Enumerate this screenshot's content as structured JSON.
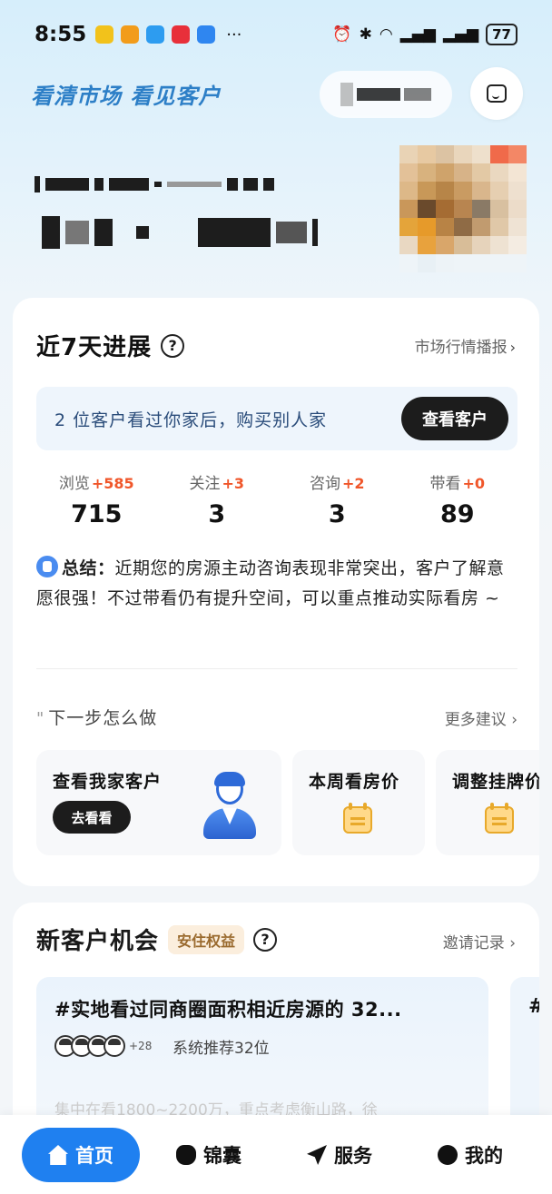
{
  "status_bar": {
    "time": "8:55",
    "battery": "77",
    "more": "···",
    "app_icon_colors": [
      "#f2c21b",
      "#f29c1b",
      "#2d9cf0",
      "#e8303a",
      "#2f86f0"
    ]
  },
  "header": {
    "slogan": "看清市场 看见客户",
    "message_icon": "message-square-icon"
  },
  "progress_card": {
    "title": "近7天进展",
    "market_link": "市场行情播报",
    "alert": {
      "text": "2 位客户看过你家后，购买别人家",
      "button": "查看客户"
    },
    "stats": [
      {
        "label": "浏览",
        "delta": "+585",
        "value": "715"
      },
      {
        "label": "关注",
        "delta": "+3",
        "value": "3"
      },
      {
        "label": "咨询",
        "delta": "+2",
        "value": "3"
      },
      {
        "label": "带看",
        "delta": "+0",
        "value": "89"
      }
    ],
    "summary_label": "总结：",
    "summary_text": "近期您的房源主动咨询表现非常突出，客户了解意愿很强！不过带看仍有提升空间，可以重点推动实际看房 ~",
    "next_title": "下一步怎么做",
    "next_link": "更多建议",
    "suggestions": [
      {
        "title": "查看我家客户",
        "button": "去看看"
      },
      {
        "title": "本周看房价"
      },
      {
        "title": "调整挂牌价"
      }
    ]
  },
  "opportunity_card": {
    "title": "新客户机会",
    "badge": "安住权益",
    "link": "邀请记录",
    "item": {
      "title": "#实地看过同商圈面积相近房源的 32...",
      "face_count": "+28",
      "subtitle": "系统推荐32位",
      "faded_text": "集中在看1800~2200万，重点考虑衡山路，徐"
    },
    "next_item_hash": "#"
  },
  "tabbar": {
    "home": "首页",
    "bag": "锦囊",
    "service": "服务",
    "mine": "我的"
  },
  "colors": {
    "accent": "#1f80f0",
    "delta": "#f0562a",
    "slogan": "#2d7fc7"
  }
}
